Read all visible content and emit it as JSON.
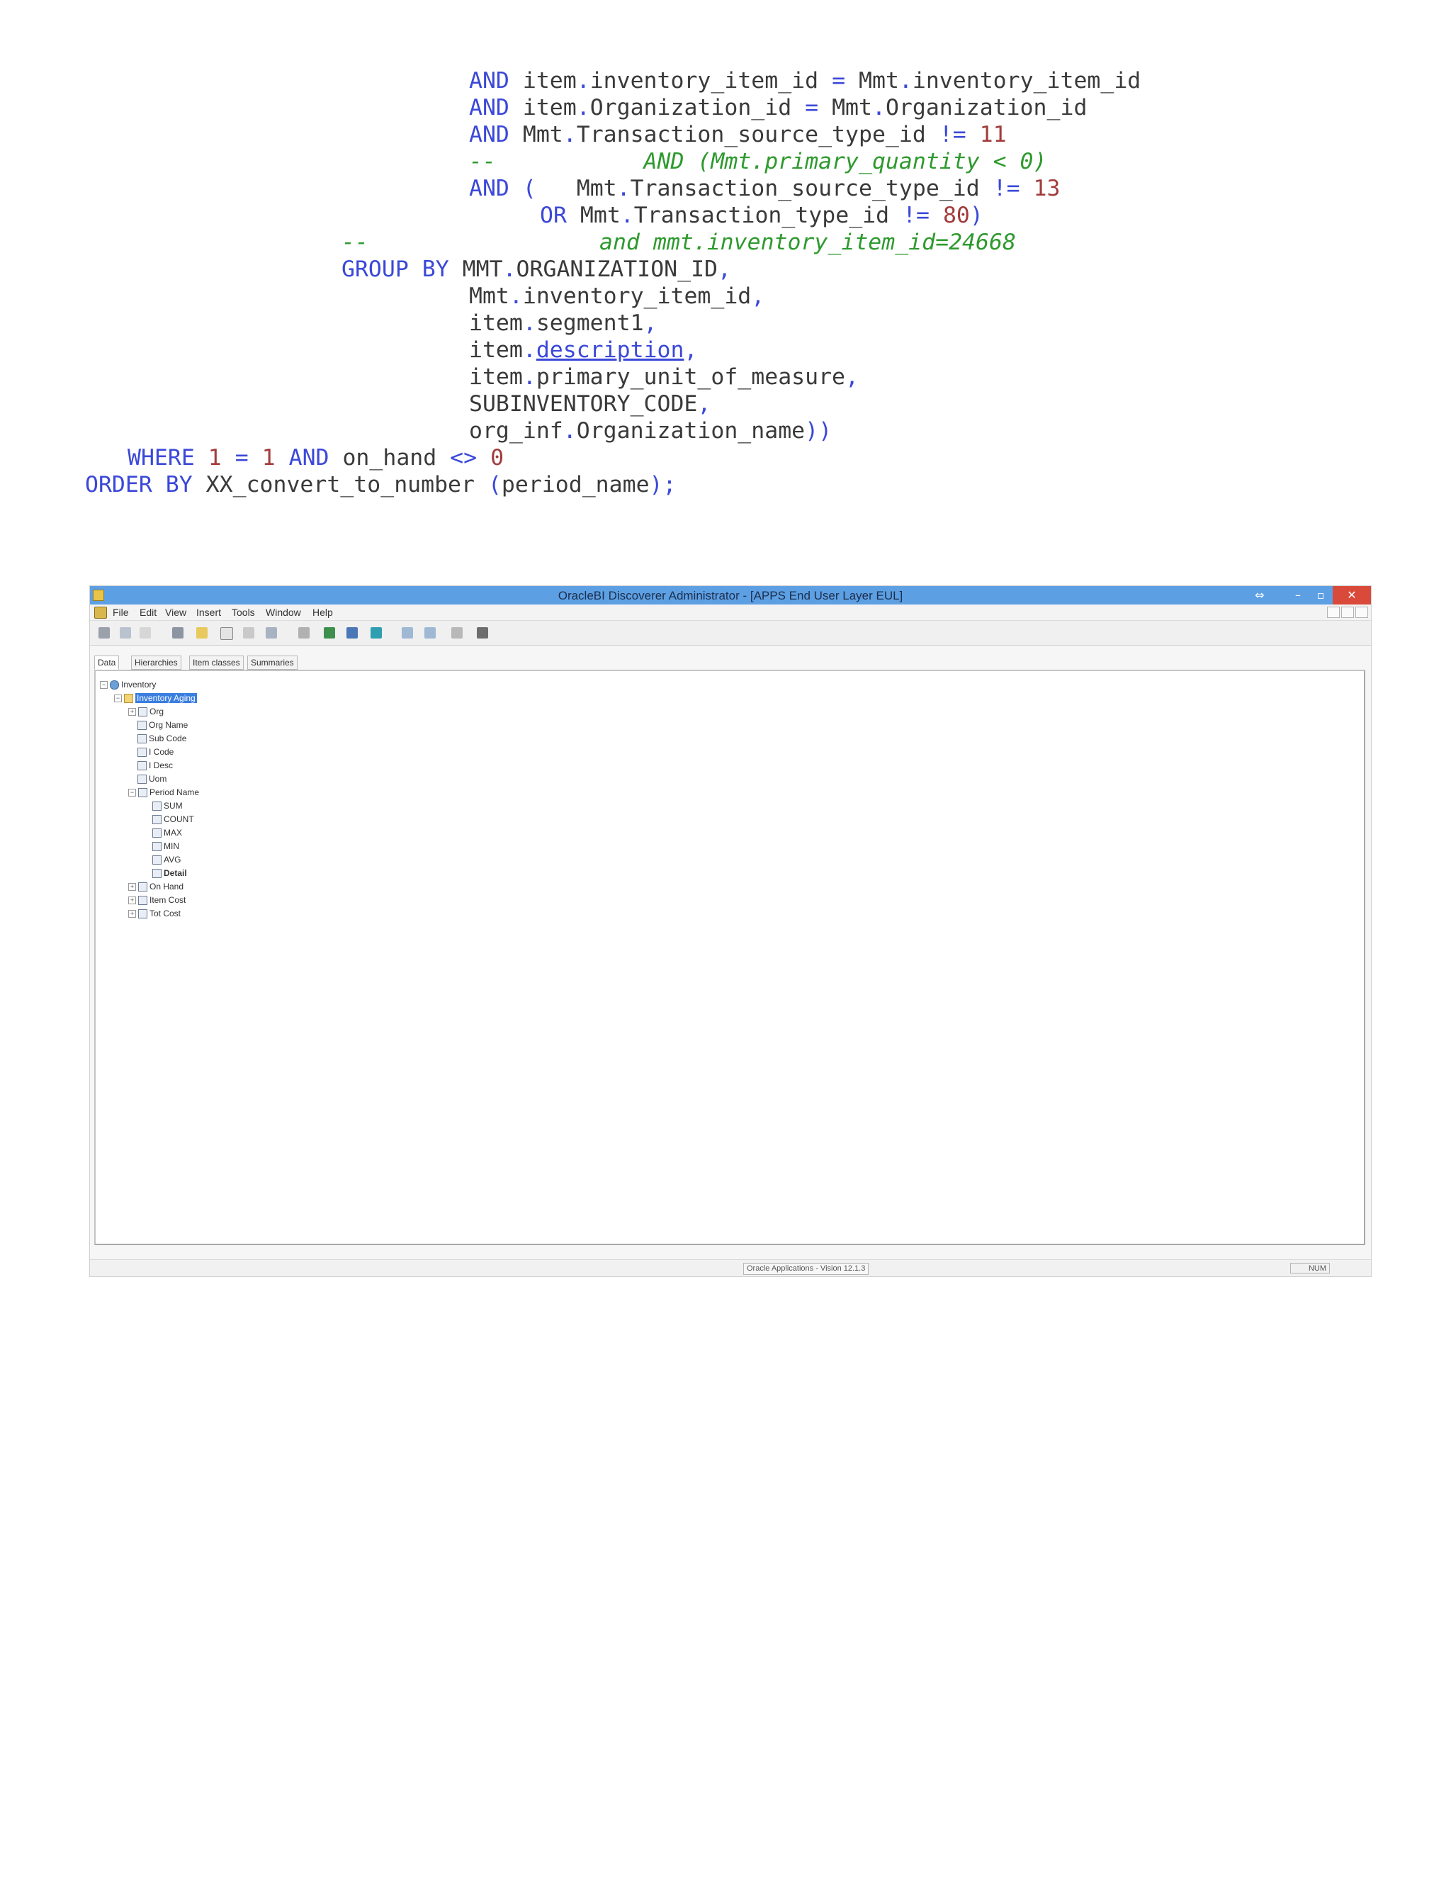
{
  "code": {
    "line1": {
      "k1": "AND",
      "t1": " item",
      "p1": ".",
      "t2": "inventory_item_id ",
      "p2": "=",
      "t3": " Mmt",
      "p3": ".",
      "t4": "inventory_item_id"
    },
    "line2": {
      "k1": "AND",
      "t1": " item",
      "p1": ".",
      "t2": "Organization_id ",
      "p2": "=",
      "t3": " Mmt",
      "p3": ".",
      "t4": "Organization_id"
    },
    "line3": {
      "k1": "AND",
      "t1": " Mmt",
      "p1": ".",
      "t2": "Transaction_source_type_id ",
      "p2": "!=",
      "n1": " 11"
    },
    "line4": {
      "c1": "--           AND (Mmt.primary_quantity < 0)"
    },
    "line5": {
      "k1": "AND",
      "p1": " (",
      "t1": "   Mmt",
      "p2": ".",
      "t2": "Transaction_source_type_id ",
      "p3": "!=",
      "n1": " 13"
    },
    "line6": {
      "k1": "OR",
      "t1": " Mmt",
      "p1": ".",
      "t2": "Transaction_type_id ",
      "p2": "!=",
      "n1": " 80",
      "p3": ")"
    },
    "line7": {
      "c1": "--",
      "c2": "and mmt.inventory_item_id=24668"
    },
    "line8": {
      "k1": "GROUP BY",
      "t1": " MMT",
      "p1": ".",
      "t2": "ORGANIZATION_ID",
      "p2": ","
    },
    "line9": {
      "t1": "Mmt",
      "p1": ".",
      "t2": "inventory_item_id",
      "p2": ","
    },
    "line10": {
      "t1": "item",
      "p1": ".",
      "t2": "segment1",
      "p2": ","
    },
    "line11": {
      "t1": "item",
      "p1": ".",
      "l1": "description",
      "p2": ","
    },
    "line12": {
      "t1": "item",
      "p1": ".",
      "t2": "primary_unit_of_measure",
      "p2": ","
    },
    "line13": {
      "t1": "SUBINVENTORY_CODE",
      "p1": ","
    },
    "line14": {
      "t1": "org_inf",
      "p1": ".",
      "t2": "Organization_name",
      "p2": "))"
    },
    "line15": {
      "k1": "WHERE",
      "n1": " 1",
      "p1": " =",
      "n2": " 1",
      "k2": " AND",
      "t1": " on_hand",
      "p2": " <>",
      "n3": " 0"
    },
    "line16": {
      "k1": "ORDER BY",
      "t1": " XX_convert_to_number ",
      "p1": "(",
      "t2": "period_name",
      "p2": ");"
    }
  },
  "screenshot": {
    "title": "OracleBI Discoverer Administrator - [APPS End User Layer  EUL]",
    "menu": [
      "File",
      "Edit",
      "View",
      "Insert",
      "Tools",
      "Window",
      "Help"
    ],
    "tabs": [
      "Data",
      "Hierarchies",
      "Item classes",
      "Summaries"
    ],
    "tree": {
      "root": "Inventory",
      "folder": "Inventory Aging",
      "items": [
        "Org",
        "Org Name",
        "Sub Code",
        "I Code",
        "I Desc",
        "Uom",
        "Period Name"
      ],
      "period_items": [
        "SUM",
        "COUNT",
        "MAX",
        "MIN",
        "AVG",
        "Detail"
      ],
      "more_items": [
        "On Hand",
        "Item Cost",
        "Tot Cost"
      ]
    },
    "status": {
      "connection": "Oracle Applications - Vision 12.1.3",
      "num": "NUM"
    }
  }
}
